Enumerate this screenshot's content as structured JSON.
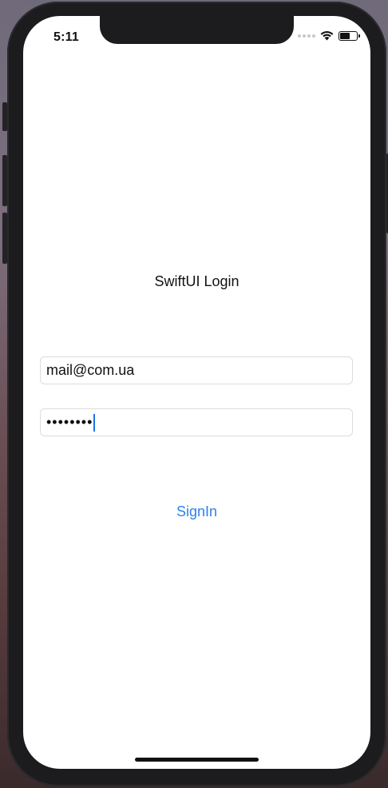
{
  "status_bar": {
    "time": "5:11"
  },
  "login": {
    "title": "SwiftUI Login",
    "email_value": "mail@com.ua",
    "password_value": "••••••••",
    "signin_label": "SignIn"
  },
  "colors": {
    "accent": "#2f80ed",
    "caret": "#1a73e8"
  },
  "icons": [
    "cellular-signal-icon",
    "wifi-icon",
    "battery-icon"
  ]
}
